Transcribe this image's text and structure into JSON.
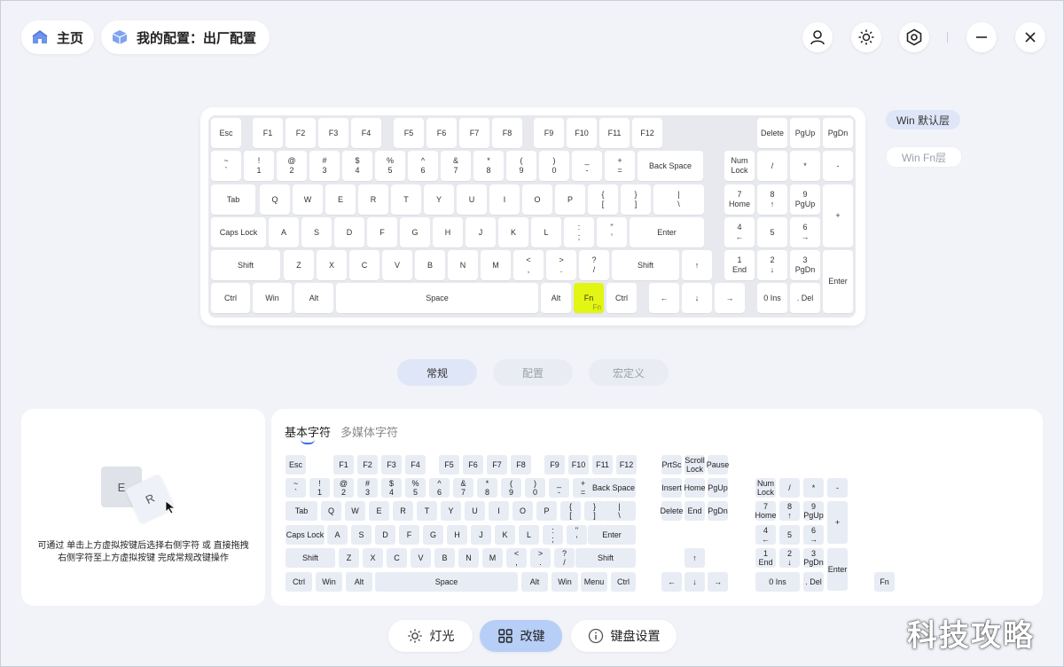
{
  "header": {
    "home_label": "主页",
    "config_label": "我的配置：出厂配置"
  },
  "layers": {
    "default": "Win 默认层",
    "fn": "Win Fn层"
  },
  "keyboard": {
    "highlighted_key": "Fn",
    "highlighted_sub": "Fn",
    "highlight_color": "#e2f513",
    "rows": [
      [
        "Esc",
        "F1",
        "F2",
        "F3",
        "F4",
        "F5",
        "F6",
        "F7",
        "F8",
        "F9",
        "F10",
        "F11",
        "F12",
        "Delete",
        "PgUp",
        "PgDn"
      ],
      [
        "~\n`",
        "!\n1",
        "@\n2",
        "#\n3",
        "$\n4",
        "%\n5",
        "^\n6",
        "&\n7",
        "*\n8",
        "(\n9",
        ")\n0",
        "_\n-",
        "+\n=",
        "Back Space",
        "Num\nLock",
        "/",
        "*",
        "-"
      ],
      [
        "Tab",
        "Q",
        "W",
        "E",
        "R",
        "T",
        "Y",
        "U",
        "I",
        "O",
        "P",
        "{\n[",
        "}\n]",
        "|\n\\",
        "7\nHome",
        "8\n↑",
        "9\nPgUp",
        "+"
      ],
      [
        "Caps Lock",
        "A",
        "S",
        "D",
        "F",
        "G",
        "H",
        "J",
        "K",
        "L",
        ":\n;",
        "\"\n'",
        "Enter",
        "4\n←",
        "5",
        "6\n→"
      ],
      [
        "Shift",
        "Z",
        "X",
        "C",
        "V",
        "B",
        "N",
        "M",
        "<\n,",
        ">\n.",
        "?\n/",
        "Shift",
        "↑",
        "1\nEnd",
        "2\n↓",
        "3\nPgDn",
        "Enter"
      ],
      [
        "Ctrl",
        "Win",
        "Alt",
        "Space",
        "Alt",
        "Fn",
        "Ctrl",
        "←",
        "↓",
        "→",
        "0 Ins",
        ". Del"
      ]
    ]
  },
  "tabs": [
    "常规",
    "配置",
    "宏定义"
  ],
  "left_panel": {
    "key_e": "E",
    "key_r": "R",
    "hint_line1": "可通过 单击上方虚拟按键后选择右侧字符 或 直接拖拽",
    "hint_line2": "右侧字符至上方虚拟按键 完成常规改键操作"
  },
  "char_tabs": {
    "basic": "基本字符",
    "media": "多媒体字符"
  },
  "char_keys": {
    "main": [
      [
        "Esc",
        "F1",
        "F2",
        "F3",
        "F4",
        "F5",
        "F6",
        "F7",
        "F8",
        "F9",
        "F10",
        "F11",
        "F12"
      ],
      [
        "~\n`",
        "!\n1",
        "@\n2",
        "#\n3",
        "$\n4",
        "%\n5",
        "^\n6",
        "&\n7",
        "*\n8",
        "(\n9",
        ")\n0",
        "_\n-",
        "+\n=",
        "Back Space"
      ],
      [
        "Tab",
        "Q",
        "W",
        "E",
        "R",
        "T",
        "Y",
        "U",
        "I",
        "O",
        "P",
        "{\n[",
        "}\n]",
        "|\n\\"
      ],
      [
        "Caps Lock",
        "A",
        "S",
        "D",
        "F",
        "G",
        "H",
        "J",
        "K",
        "L",
        ":\n;",
        "\"\n'",
        "Enter"
      ],
      [
        "Shift",
        "Z",
        "X",
        "C",
        "V",
        "B",
        "N",
        "M",
        "<\n,",
        ">\n.",
        "?\n/",
        "Shift"
      ],
      [
        "Ctrl",
        "Win",
        "Alt",
        "Space",
        "Alt",
        "Win",
        "Menu",
        "Ctrl"
      ]
    ],
    "nav": [
      "PrtSc",
      "Scroll\nLock",
      "Pause",
      "Insert",
      "Home",
      "PgUp",
      "Delete",
      "End",
      "PgDn",
      "↑",
      "←",
      "↓",
      "→"
    ],
    "numpad": [
      "Num\nLock",
      "/",
      "*",
      "-",
      "7\nHome",
      "8\n↑",
      "9\nPgUp",
      "+",
      "4\n←",
      "5",
      "6\n→",
      "1\nEnd",
      "2\n↓",
      "3\nPgDn",
      "Enter",
      "0 Ins",
      ". Del"
    ],
    "fn": "Fn"
  },
  "bottom_nav": {
    "light": "灯光",
    "remap": "改键",
    "settings": "键盘设置"
  },
  "watermark": "科技攻略",
  "colors": {
    "accent": "#b7cef7",
    "active_tab": "#dfe6f7",
    "layer_active": "#dfe6f7"
  }
}
